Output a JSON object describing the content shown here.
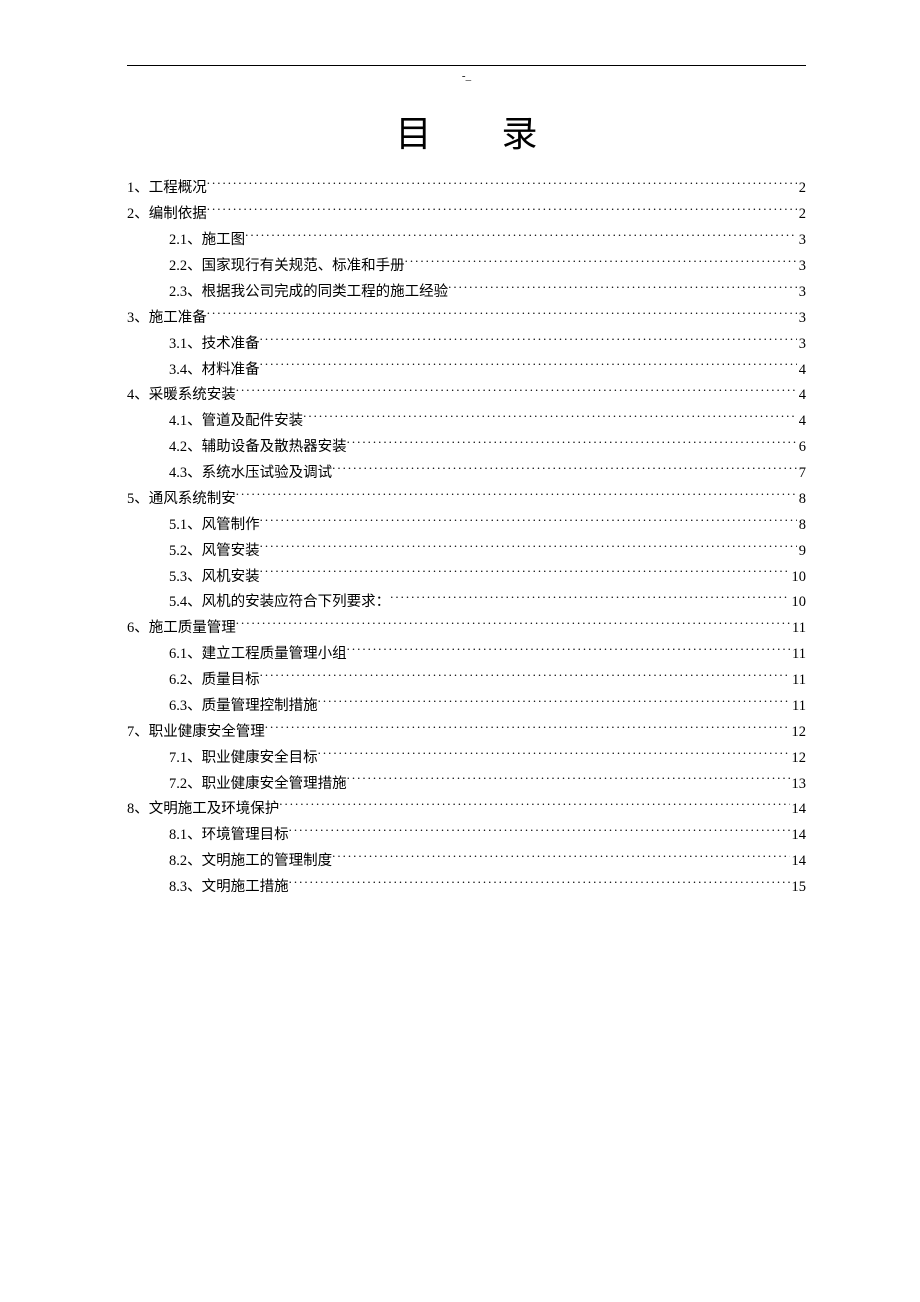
{
  "header_mark": "-_",
  "title": "目录",
  "toc": [
    {
      "level": 1,
      "label": "1、工程概况",
      "page": "2"
    },
    {
      "level": 1,
      "label": "2、编制依据",
      "page": "2"
    },
    {
      "level": 2,
      "label": "2.1、施工图",
      "page": "3"
    },
    {
      "level": 2,
      "label": "2.2、国家现行有关规范、标准和手册",
      "page": "3"
    },
    {
      "level": 2,
      "label": "2.3、根据我公司完成的同类工程的施工经验",
      "page": "3"
    },
    {
      "level": 1,
      "label": "3、施工准备",
      "page": "3"
    },
    {
      "level": 2,
      "label": "3.1、技术准备",
      "page": "3"
    },
    {
      "level": 2,
      "label": "3.4、材料准备",
      "page": "4"
    },
    {
      "level": 1,
      "label": "4、采暖系统安装",
      "page": "4"
    },
    {
      "level": 2,
      "label": "4.1、管道及配件安装",
      "page": "4"
    },
    {
      "level": 2,
      "label": "4.2、辅助设备及散热器安装",
      "page": "6"
    },
    {
      "level": 2,
      "label": "4.3、系统水压试验及调试",
      "page": "7"
    },
    {
      "level": 1,
      "label": "5、通风系统制安",
      "page": "8"
    },
    {
      "level": 2,
      "label": "5.1、风管制作",
      "page": "8"
    },
    {
      "level": 2,
      "label": "5.2、风管安装",
      "page": "9"
    },
    {
      "level": 2,
      "label": "5.3、风机安装",
      "page": "10"
    },
    {
      "level": 2,
      "label": "5.4、风机的安装应符合下列要求：",
      "page": "10"
    },
    {
      "level": 1,
      "label": "6、施工质量管理",
      "page": "11"
    },
    {
      "level": 2,
      "label": "6.1、建立工程质量管理小组",
      "page": "11"
    },
    {
      "level": 2,
      "label": "6.2、质量目标",
      "page": "11"
    },
    {
      "level": 2,
      "label": "6.3、质量管理控制措施",
      "page": "11"
    },
    {
      "level": 1,
      "label": "7、职业健康安全管理",
      "page": "12"
    },
    {
      "level": 2,
      "label": "7.1、职业健康安全目标",
      "page": "12"
    },
    {
      "level": 2,
      "label": "7.2、职业健康安全管理措施",
      "page": "13"
    },
    {
      "level": 1,
      "label": "8、文明施工及环境保护",
      "page": "14"
    },
    {
      "level": 2,
      "label": "8.1、环境管理目标",
      "page": "14"
    },
    {
      "level": 2,
      "label": "8.2、文明施工的管理制度",
      "page": "14"
    },
    {
      "level": 2,
      "label": "8.3、文明施工措施",
      "page": "15"
    }
  ]
}
